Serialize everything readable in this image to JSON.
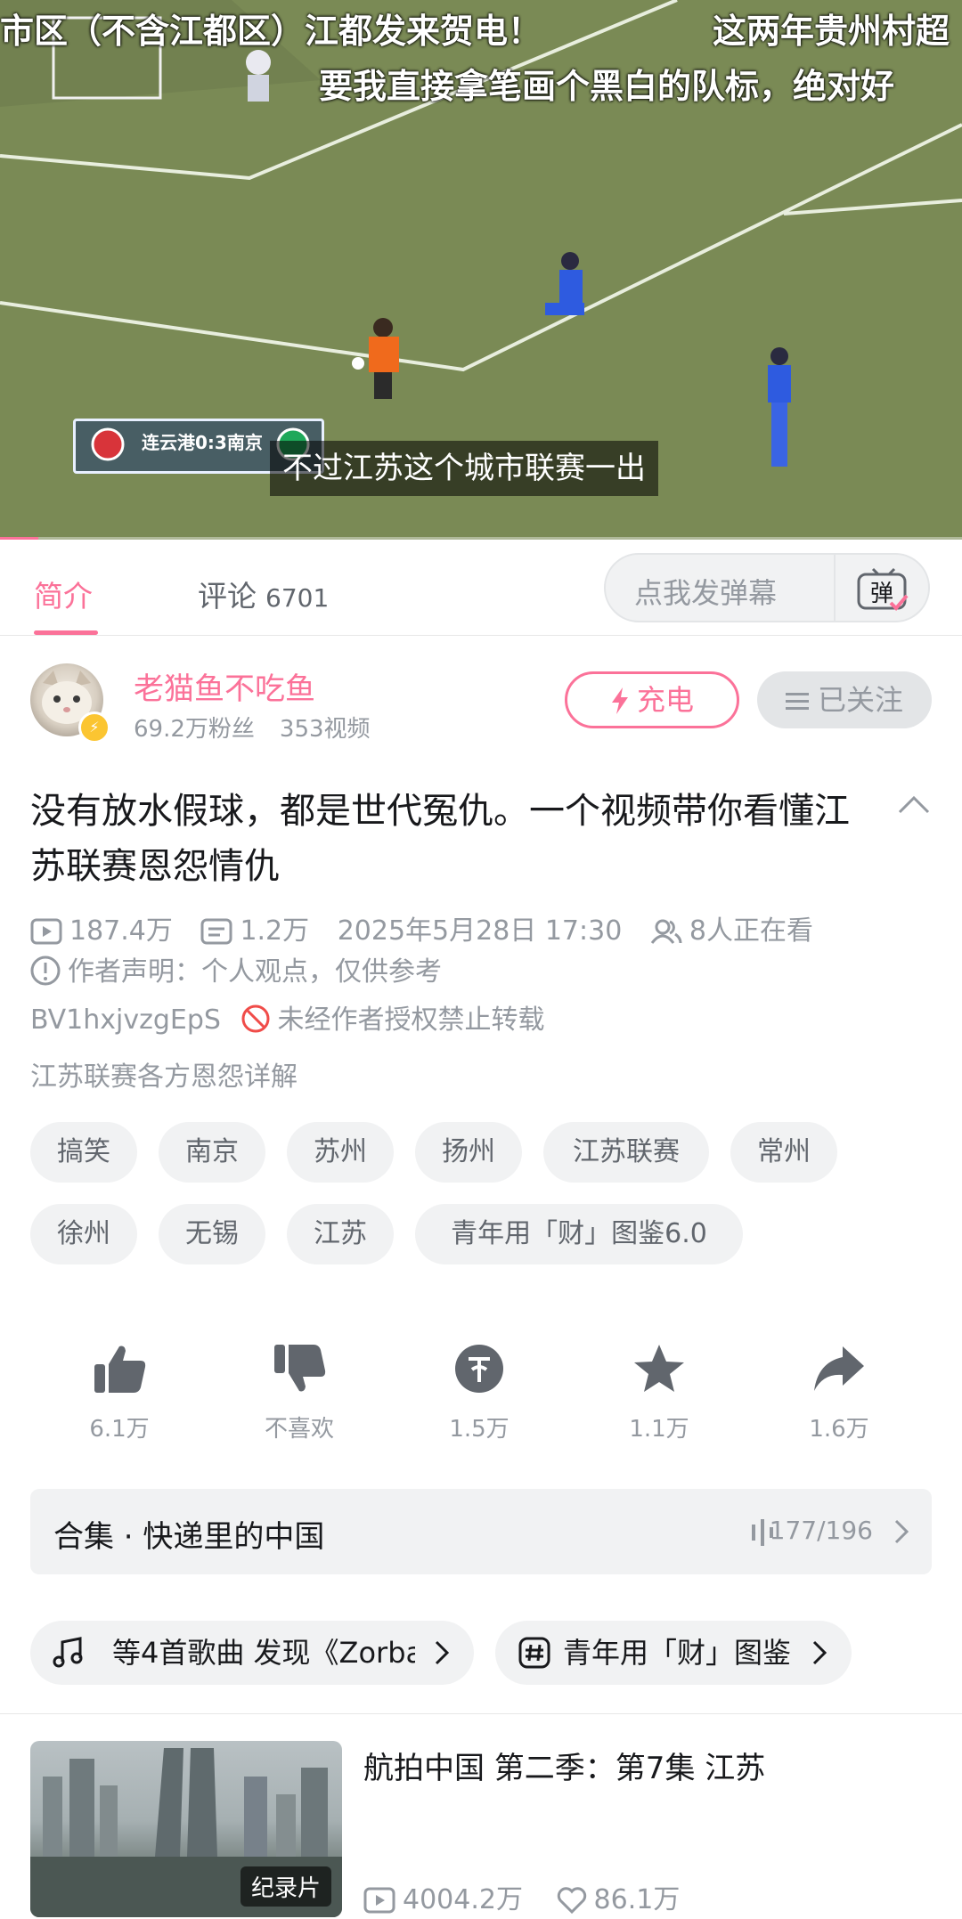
{
  "video": {
    "danmaku": [
      "市区（不含江都区）江都发来贺电！",
      "这两年贵州村超",
      "要我直接拿笔画个黑白的队标，绝对好"
    ],
    "subtitle": "不过江苏这个城市联赛一出",
    "scoreboard": "连云港0:3南京",
    "progress_fraction": 0.04
  },
  "tabs": {
    "intro_label": "简介",
    "comments_label": "评论",
    "comments_count": "6701",
    "danmaku_placeholder": "点我发弹幕",
    "danmaku_icon_text": "弹"
  },
  "author": {
    "name": "老猫鱼不吃鱼",
    "followers": "69.2万粉丝",
    "videos": "353视频",
    "charge_label": "充电",
    "follow_label": "已关注"
  },
  "video_info": {
    "title": "没有放水假球，都是世代冤仇。一个视频带你看懂江苏联赛恩怨情仇",
    "views": "187.4万",
    "danmaku_count": "1.2万",
    "publish_time": "2025年5月28日 17:30",
    "watching": "8人正在看",
    "statement": "作者声明：个人观点，仅供参考",
    "bvid": "BV1hxjvzgEpS",
    "reprint_notice": "未经作者授权禁止转载",
    "description": "江苏联赛各方恩怨详解"
  },
  "tags": [
    "搞笑",
    "南京",
    "苏州",
    "扬州",
    "江苏联赛",
    "常州",
    "徐州",
    "无锡",
    "江苏",
    "青年用「财」图鉴6.0"
  ],
  "actions": {
    "like": "6.1万",
    "dislike": "不喜欢",
    "coin": "1.5万",
    "favorite": "1.1万",
    "share": "1.6万"
  },
  "collection": {
    "name": "合集 · 快递里的中国",
    "progress": "177/196"
  },
  "chips": {
    "music": "等4首歌曲   发现《Zorba",
    "topic": "青年用「财」图鉴"
  },
  "related": {
    "title": "航拍中国 第二季：第7集 江苏",
    "badge": "纪录片",
    "views": "4004.2万",
    "likes": "86.1万"
  },
  "colors": {
    "accent": "#fb7299",
    "secondary_text": "#9499a0",
    "chip_bg": "#f1f2f3"
  }
}
